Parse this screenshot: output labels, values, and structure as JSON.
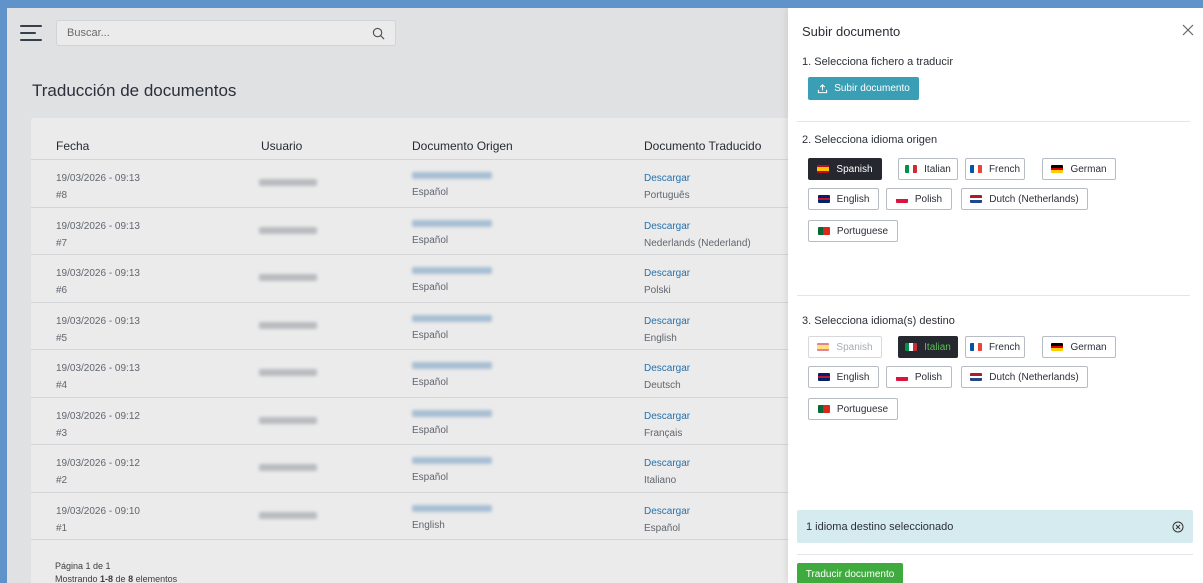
{
  "search": {
    "placeholder": "Buscar..."
  },
  "page": {
    "title": "Traducción de documentos"
  },
  "table": {
    "headers": {
      "fecha": "Fecha",
      "usuario": "Usuario",
      "origen": "Documento Origen",
      "traducido": "Documento Traducido"
    },
    "rows": [
      {
        "date": "19/03/2026 - 09:13",
        "id": "#8",
        "source_lang": "Español",
        "download": "Descargar",
        "target_lang": "Português"
      },
      {
        "date": "19/03/2026 - 09:13",
        "id": "#7",
        "source_lang": "Español",
        "download": "Descargar",
        "target_lang": "Nederlands (Nederland)"
      },
      {
        "date": "19/03/2026 - 09:13",
        "id": "#6",
        "source_lang": "Español",
        "download": "Descargar",
        "target_lang": "Polski"
      },
      {
        "date": "19/03/2026 - 09:13",
        "id": "#5",
        "source_lang": "Español",
        "download": "Descargar",
        "target_lang": "English"
      },
      {
        "date": "19/03/2026 - 09:13",
        "id": "#4",
        "source_lang": "Español",
        "download": "Descargar",
        "target_lang": "Deutsch"
      },
      {
        "date": "19/03/2026 - 09:12",
        "id": "#3",
        "source_lang": "Español",
        "download": "Descargar",
        "target_lang": "Français"
      },
      {
        "date": "19/03/2026 - 09:12",
        "id": "#2",
        "source_lang": "Español",
        "download": "Descargar",
        "target_lang": "Italiano"
      },
      {
        "date": "19/03/2026 - 09:10",
        "id": "#1",
        "source_lang": "English",
        "download": "Descargar",
        "target_lang": "Español"
      }
    ]
  },
  "pagination": {
    "page_text": "Página 1 de 1",
    "showing_prefix": "Mostrando ",
    "range": "1-8",
    "of": " de ",
    "total": "8",
    "suffix": " elementos"
  },
  "drawer": {
    "title": "Subir documento",
    "step1": "1. Selecciona fichero a traducir",
    "upload_label": "Subir documento",
    "step2": "2. Selecciona idioma origen",
    "step3": "3. Selecciona idioma(s) destino",
    "languages": [
      "Spanish",
      "Italian",
      "French",
      "German",
      "English",
      "Polish",
      "Dutch (Netherlands)",
      "Portuguese"
    ],
    "source_selected": "Spanish",
    "target_selected": [
      "Italian"
    ],
    "target_disabled": [
      "Spanish"
    ],
    "info_text": "1 idioma destino seleccionado",
    "submit_label": "Traducir documento"
  },
  "colors": {
    "upload": "#3a9fb5",
    "submit": "#3fab3f",
    "info_bg": "#d6ebef",
    "link": "#2b7bb9",
    "selected": "#25282e"
  }
}
